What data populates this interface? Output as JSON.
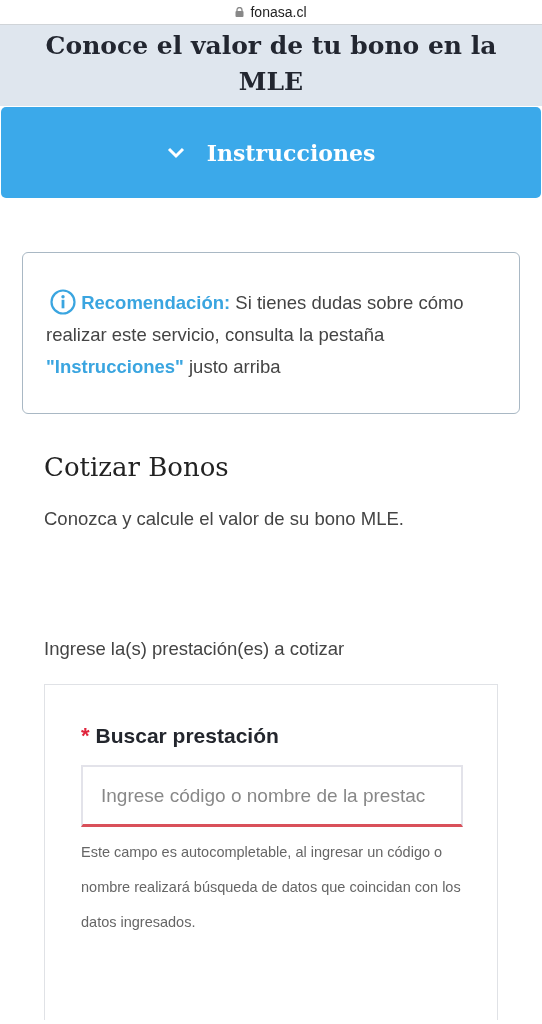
{
  "browser": {
    "url": "fonasa.cl"
  },
  "header": {
    "title": "Conoce el valor de tu bono en la MLE"
  },
  "accordion": {
    "label": "Instrucciones",
    "expanded": false
  },
  "alert": {
    "text": "**Recomendación:** Si tienes dudas sobre cómo realizar este servicio, consulta la pestaña **\"Instrucciones\"** justo arriba"
  },
  "section": {
    "title": "Cotizar Bonos",
    "subtitle": "Conozca y calcule el valor de su bono MLE.",
    "prompt": "Ingrese la(s) prestación(es) a cotizar"
  },
  "search": {
    "label": "Buscar prestación",
    "required": true,
    "required_mark": "*",
    "placeholder": "Ingrese código o nombre de la prestac",
    "invalid": true,
    "help": "Este campo es autocompletable, al ingresar un código o nombre realizará búsqueda de datos que coincidan con los datos ingresados."
  }
}
